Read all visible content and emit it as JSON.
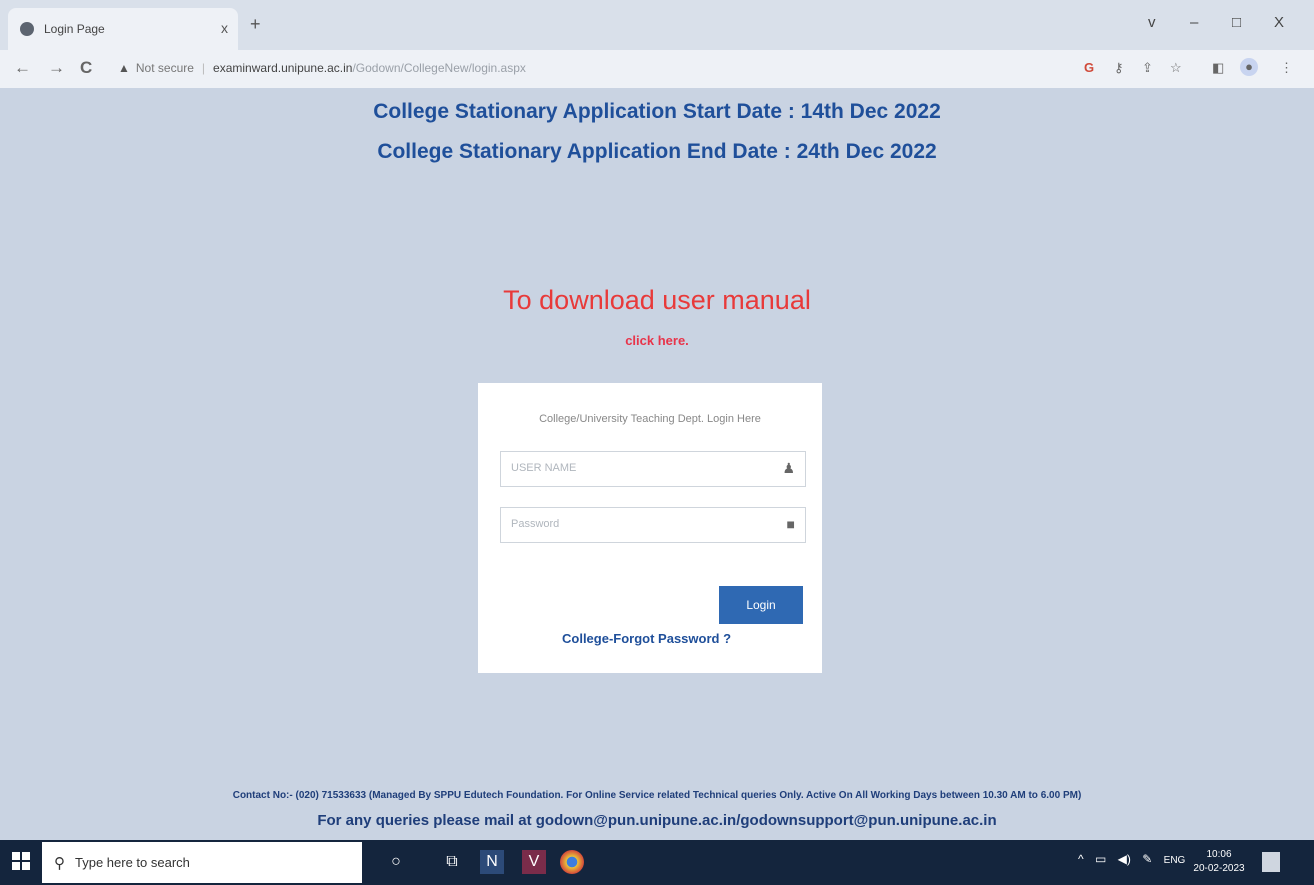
{
  "browser": {
    "tab_title": "Login Page",
    "tab_close": "x",
    "new_tab": "+",
    "nav_back": "←",
    "nav_forward": "→",
    "nav_reload": "C",
    "security_warning_icon": "▲",
    "security_label": "Not secure",
    "url_host": "examinward.unipune.ac.in",
    "url_path": "/Godown/CollegeNew/login.aspx",
    "window_controls": [
      "v",
      "–",
      "□",
      "X"
    ],
    "toolbar_icons": [
      "google-icon",
      "key-icon",
      "share-icon",
      "star-icon",
      "sidebar-icon",
      "profile-icon",
      "menu-icon"
    ]
  },
  "page": {
    "start_date_line": "College Stationary Application Start Date : 14th Dec 2022",
    "end_date_line": "College Stationary Application End Date : 24th Dec 2022",
    "manual_title": "To download user manual",
    "manual_link": "click here.",
    "login": {
      "title": "College/University Teaching Dept. Login Here",
      "username_placeholder": "USER NAME",
      "password_placeholder": "Password",
      "button_label": "Login",
      "forgot_label": "College-Forgot Password ?"
    },
    "contact": "Contact No:- (020) 71533633 (Managed By SPPU Edutech Foundation. For Online Service related Technical queries Only. Active On All Working Days between 10.30 AM to 6.00 PM)",
    "mail_line": "For any queries please mail at godown@pun.unipune.ac.in/godownsupport@pun.unipune.ac.in"
  },
  "taskbar": {
    "search_placeholder": "Type here to search",
    "language": "ENG",
    "time": "10:06",
    "date": "20-02-2023"
  },
  "colors": {
    "page_bg": "#c9d3e2",
    "headline": "#1f4f9a",
    "manual_red": "#e83a3a",
    "login_button": "#2f69b3",
    "taskbar": "#14253d"
  }
}
